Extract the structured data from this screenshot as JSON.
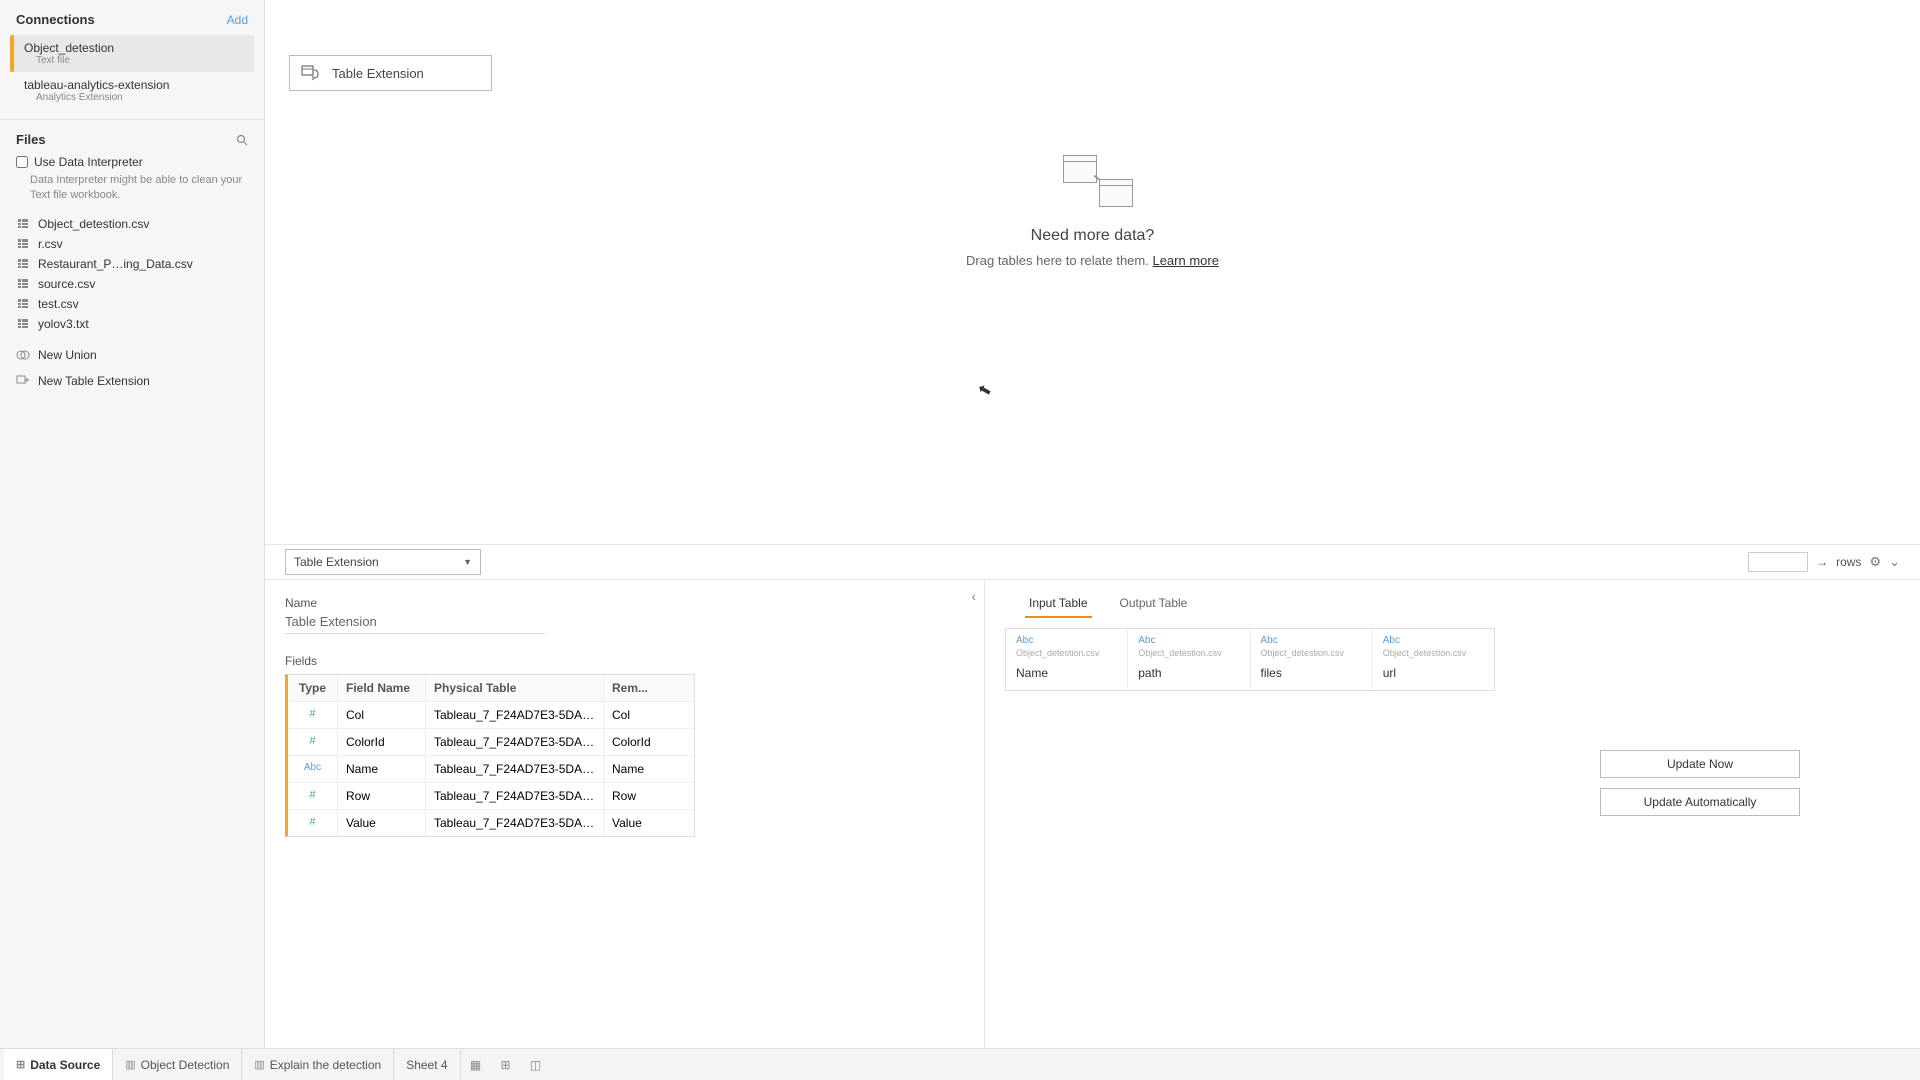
{
  "sidebar": {
    "connections_header": "Connections",
    "add_label": "Add",
    "connections": [
      {
        "name": "Object_detestion",
        "subtitle": "Text file",
        "active": true
      },
      {
        "name": "tableau-analytics-extension",
        "subtitle": "Analytics Extension",
        "active": false
      }
    ],
    "files_header": "Files",
    "data_interpreter": {
      "label": "Use Data Interpreter",
      "hint": "Data Interpreter might be able to clean your Text file workbook."
    },
    "files": [
      "Object_detestion.csv",
      "r.csv",
      "Restaurant_P…ing_Data.csv",
      "source.csv",
      "test.csv",
      "yolov3.txt"
    ],
    "actions": {
      "new_union": "New Union",
      "new_table_ext": "New Table Extension"
    }
  },
  "canvas": {
    "chip_label": "Table Extension",
    "empty_title": "Need more data?",
    "empty_sub_prefix": "Drag tables here to relate them. ",
    "empty_link": "Learn more"
  },
  "midbar": {
    "dropdown_label": "Table Extension",
    "rows_label": "rows",
    "rows_value": ""
  },
  "details": {
    "name_label": "Name",
    "name_value": "Table Extension",
    "fields_label": "Fields",
    "headers": {
      "type": "Type",
      "field_name": "Field Name",
      "physical": "Physical Table",
      "remote": "Rem..."
    },
    "rows": [
      {
        "type": "num",
        "field": "Col",
        "physical": "Tableau_7_F24AD7E3-5DA8-...",
        "remote": "Col"
      },
      {
        "type": "num",
        "field": "ColorId",
        "physical": "Tableau_7_F24AD7E3-5DA8-...",
        "remote": "ColorId"
      },
      {
        "type": "abc",
        "field": "Name",
        "physical": "Tableau_7_F24AD7E3-5DA8-...",
        "remote": "Name"
      },
      {
        "type": "num",
        "field": "Row",
        "physical": "Tableau_7_F24AD7E3-5DA8-...",
        "remote": "Row"
      },
      {
        "type": "num",
        "field": "Value",
        "physical": "Tableau_7_F24AD7E3-5DA8-...",
        "remote": "Value"
      }
    ]
  },
  "io": {
    "tab_input": "Input Table",
    "tab_output": "Output Table",
    "source": "Object_detestion.csv",
    "type_label": "Abc",
    "cols": [
      "Name",
      "path",
      "files",
      "url"
    ],
    "update_now": "Update Now",
    "update_auto": "Update Automatically"
  },
  "footer": {
    "data_source": "Data Source",
    "tabs": [
      "Object Detection",
      "Explain the detection",
      "Sheet 4"
    ]
  }
}
